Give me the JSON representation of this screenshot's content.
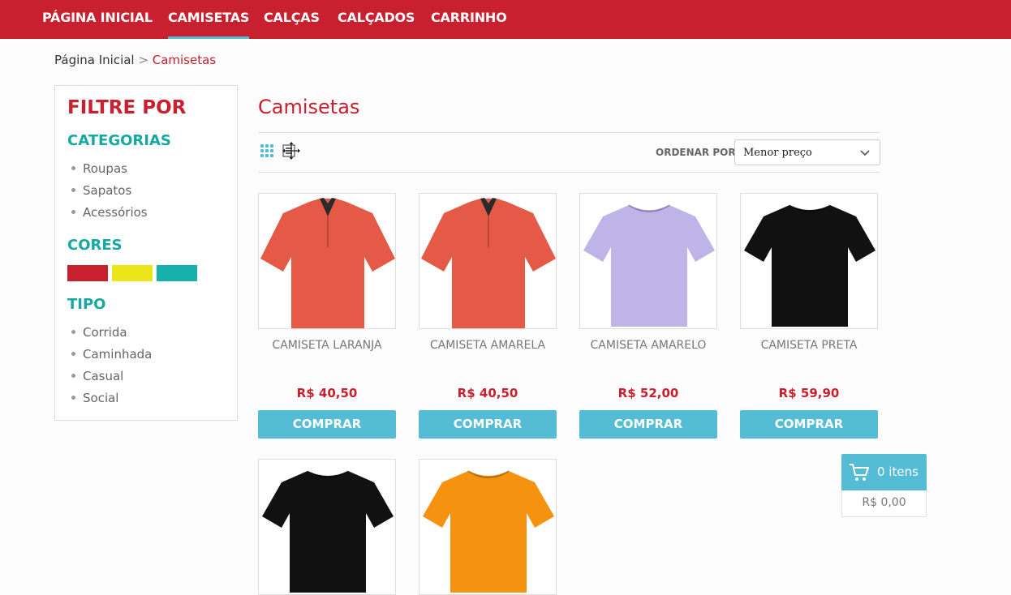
{
  "nav": {
    "items": [
      "PÁGINA INICIAL",
      "CAMISETAS",
      "CALÇAS",
      "CALÇADOS",
      "CARRINHO"
    ],
    "active_index": 1,
    "colors": {
      "bar": "#c8202e",
      "active_underline": "#55bcd6"
    }
  },
  "breadcrumb": {
    "home": "Página Inicial",
    "separator": ">",
    "current": "Camisetas"
  },
  "filters": {
    "title": "FILTRE POR",
    "categories": {
      "heading": "CATEGORIAS",
      "items": [
        "Roupas",
        "Sapatos",
        "Acessórios"
      ]
    },
    "colors": {
      "heading": "CORES",
      "swatches": [
        "#c8202e",
        "#ece51a",
        "#17b1ab"
      ]
    },
    "type": {
      "heading": "TIPO",
      "items": [
        "Corrida",
        "Caminhada",
        "Casual",
        "Social"
      ]
    }
  },
  "main": {
    "title": "Camisetas",
    "view_icons": [
      "grid-view-icon",
      "list-view-icon"
    ],
    "sort": {
      "label": "ORDENAR POR",
      "selected": "Menor preço"
    }
  },
  "products": [
    {
      "name": "CAMISETA LARANJA",
      "price": "R$ 40,50",
      "button": "COMPRAR",
      "shirt": "polo",
      "color": "#e55a46"
    },
    {
      "name": "CAMISETA AMARELA",
      "price": "R$ 40,50",
      "button": "COMPRAR",
      "shirt": "polo",
      "color": "#e55a46"
    },
    {
      "name": "CAMISETA AMARELO",
      "price": "R$ 52,00",
      "button": "COMPRAR",
      "shirt": "tee",
      "color": "#bfb4e8"
    },
    {
      "name": "CAMISETA PRETA",
      "price": "R$ 59,90",
      "button": "COMPRAR",
      "shirt": "tee",
      "color": "#111111"
    },
    {
      "name": "",
      "price": "",
      "button": "",
      "shirt": "tee",
      "color": "#111111"
    },
    {
      "name": "",
      "price": "",
      "button": "",
      "shirt": "tee",
      "color": "#f5920f"
    }
  ],
  "cart": {
    "count": "0 itens",
    "total": "R$ 0,00",
    "icon": "cart-icon"
  }
}
